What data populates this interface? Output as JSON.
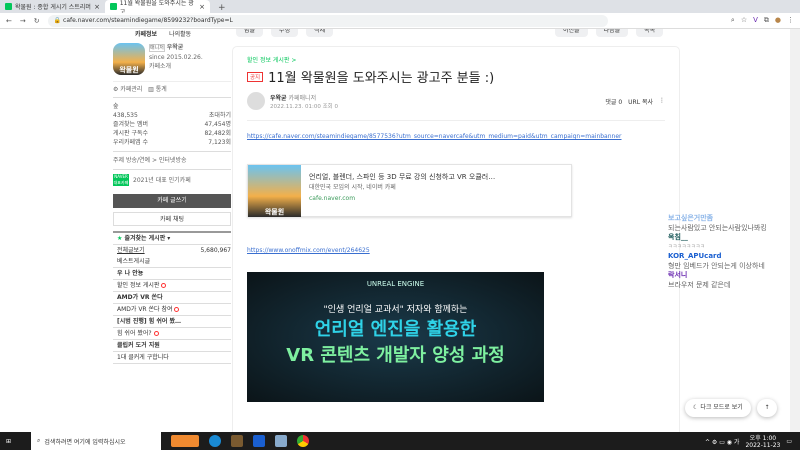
{
  "browser": {
    "tabs": [
      {
        "title": "왁물원 : 종합 게시기 스트리머"
      },
      {
        "title": "11월 왁물원을 도와주시는 광고"
      }
    ],
    "url": "cafe.naver.com/steamindiegame/8599232?boardType=L"
  },
  "sidebar": {
    "nav": [
      "카페정보",
      "나의활동"
    ],
    "manager_badge": "매니저",
    "manager": "우왁굳",
    "since": "since 2015.02.26.",
    "intro": "카페소개",
    "admin": "카페관리",
    "stats_link": "통계",
    "level": "숲",
    "members": "438,535",
    "invite": "초대하기",
    "stats": [
      {
        "label": "즐겨찾는 멤버",
        "value": "47,454명"
      },
      {
        "label": "게시판 구독수",
        "value": "82,482회"
      },
      {
        "label": "우리카페앱 수",
        "value": "7,123회"
      }
    ],
    "topic": "주제 방송/연예 > 인터넷방송",
    "award": "2021년 대표 인기카페",
    "award_badge": "NAVER 대표카페",
    "write": "카페 글쓰기",
    "chat": "카페 채팅",
    "fav_boards": "즐겨찾는 게시판",
    "menu": [
      {
        "t": "전체글보기",
        "n": "5,680,967"
      },
      {
        "t": "베스트게시글"
      },
      {
        "t": "우 나 안뇽",
        "b": true
      },
      {
        "t": "할인 정보 게시판",
        "new": true
      },
      {
        "t": "AMD가 VR 쏜다",
        "b": true
      },
      {
        "t": "AMD가 VR 쏜다 참여",
        "new": true
      },
      {
        "t": "[시범 진행] 힘 쉬어 봤…",
        "b": true
      },
      {
        "t": "힘 쉬어 봤어?",
        "new": true
      },
      {
        "t": "클립커 도거 지원",
        "b": true
      },
      {
        "t": "1대 클커게 구합니다"
      }
    ]
  },
  "toolbar": {
    "left": [
      "답글",
      "수정",
      "삭제"
    ],
    "right": [
      "이전글",
      "다음글",
      "목록"
    ]
  },
  "post": {
    "board": "할인 정보 게시판 >",
    "notice": "공지",
    "title": "11월 왁물원을 도와주시는 광고주 분들 :)",
    "author": "우왁굳",
    "role": "카페매니저",
    "date": "2022.11.23. 01:00",
    "views": "조회 0",
    "comments": "댓글 0",
    "copy": "URL 복사",
    "link1": "https://cafe.naver.com/steamindiegame/8577536?utm_source=navercafe&utm_medium=paid&utm_campaign=mainbanner",
    "og": {
      "title": "언리얼, 블렌더, 스파인 등 3D 무료 강의 신청하고 VR 오큘러…",
      "desc": "대한민국 모임의 시작, 네이버 카페",
      "site": "cafe.naver.com",
      "logo": "왁물원"
    },
    "link2": "https://www.onoffmix.com/event/264625",
    "banner": {
      "brand": "UNREAL ENGINE",
      "sub": "\"인생 언리얼 교과서\" 저자와 함께하는",
      "h1": "언리얼 엔진을 활용한",
      "h2": "VR 콘텐츠 개발자 양성 과정"
    }
  },
  "chat": [
    {
      "name": "보고싶은거만좀",
      "msg": "되는사람있고 안되는사람있나봐킹",
      "color": "#8ab4e8"
    },
    {
      "name": "옥침__",
      "msg": "ㅋㅋㅋㅋㅋㅋㅋㅋ",
      "color": "#1d5a5a"
    },
    {
      "name": "KOR_APUcard",
      "msg": "형만 임베드가 안되는게 이상하네",
      "color": "#1a5fd0"
    },
    {
      "name": "락서니",
      "msg": "브라우저 문제 같은데",
      "color": "#6a2ab0"
    }
  ],
  "floating": {
    "dark": "다크 모드로 보기",
    "top": "↑"
  },
  "taskbar": {
    "search": "검색하려면 여기에 입력하십시오",
    "time": "오후 1:00",
    "date": "2022-11-23"
  }
}
